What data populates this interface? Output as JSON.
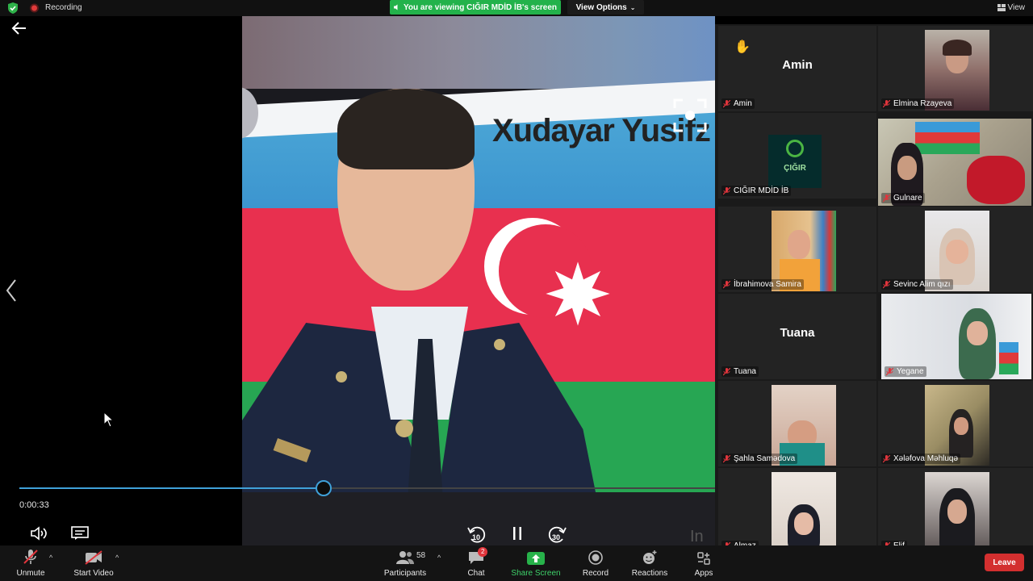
{
  "topbar": {
    "recording_label": "Recording",
    "viewing_banner": "You are viewing CIĞIR MDİD İB's screen",
    "view_options": "View Options",
    "view_label": "View"
  },
  "video": {
    "overlay_text": "Xudayar Yusifz",
    "time": "0:00:33",
    "progress_fraction": 0.437,
    "skip_back": "10",
    "skip_forward": "30",
    "logo_text": "In"
  },
  "gallery": {
    "tiles": [
      {
        "name": "Amin",
        "big_name": "Amin"
      },
      {
        "name": "Elmina Rzayeva"
      },
      {
        "name": "CIĞIR MDİD İB"
      },
      {
        "name": "Gulnare"
      },
      {
        "name": "İbrahimova Samira"
      },
      {
        "name": "Sevinc Alim qızı"
      },
      {
        "name": "Tuana",
        "big_name": "Tuana"
      },
      {
        "name": "Yegane"
      },
      {
        "name": "Şahla Samədova"
      },
      {
        "name": "Xəlǝfova Məhluqə"
      },
      {
        "name": "Almaz"
      },
      {
        "name": "Elif"
      }
    ],
    "logo_text": "ÇIĞIR"
  },
  "toolbar": {
    "unmute": "Unmute",
    "start_video": "Start Video",
    "participants": "Participants",
    "participants_count": "58",
    "chat": "Chat",
    "chat_badge": "2",
    "share_screen": "Share Screen",
    "record": "Record",
    "reactions": "Reactions",
    "apps": "Apps",
    "leave": "Leave"
  },
  "colors": {
    "banner_green": "#23b24b",
    "accent_blue": "#3fa1d9",
    "active_tile": "#d8d64f",
    "leave_red": "#d32f2f"
  }
}
